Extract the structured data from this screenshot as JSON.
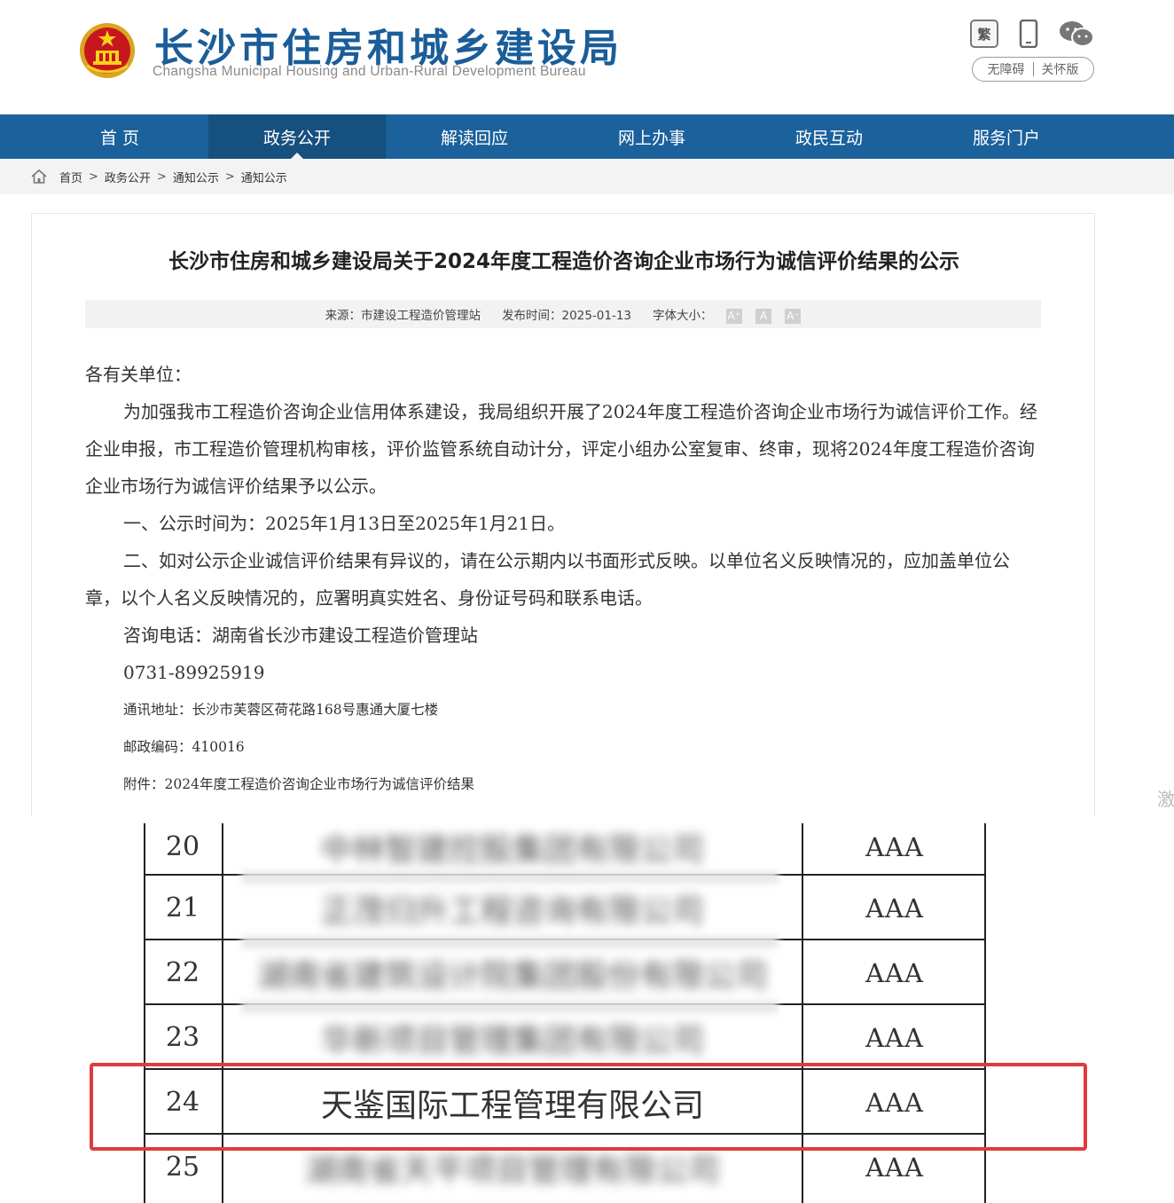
{
  "header": {
    "title": "长沙市住房和城乡建设局",
    "subtitle": "Changsha Municipal Housing and Urban-Rural Development Bureau",
    "traditional_label": "繁",
    "accessibility_label": "无障碍",
    "care_label": "关怀版"
  },
  "nav": {
    "items": [
      {
        "label": "首  页"
      },
      {
        "label": "政务公开"
      },
      {
        "label": "解读回应"
      },
      {
        "label": "网上办事"
      },
      {
        "label": "政民互动"
      },
      {
        "label": "服务门户"
      }
    ],
    "active_index": 1
  },
  "breadcrumb": [
    "首页",
    "政务公开",
    "通知公示",
    "通知公示"
  ],
  "breadcrumb_sep": ">",
  "article": {
    "title": "长沙市住房和城乡建设局关于2024年度工程造价咨询企业市场行为诚信评价结果的公示",
    "source": "来源：市建设工程造价管理站",
    "publish_time": "发布时间：2025-01-13",
    "font_size_label": "字体大小：",
    "font_buttons": [
      "A⁺",
      "A",
      "A⁻"
    ],
    "greeting": "各有关单位：",
    "para1": "为加强我市工程造价咨询企业信用体系建设，我局组织开展了2024年度工程造价咨询企业市场行为诚信评价工作。经企业申报，市工程造价管理机构审核，评价监管系统自动计分，评定小组办公室复审、终审，现将2024年度工程造价咨询企业市场行为诚信评价结果予以公示。",
    "para2": "一、公示时间为：2025年1月13日至2025年1月21日。",
    "para3": "二、如对公示企业诚信评价结果有异议的，请在公示期内以书面形式反映。以单位名义反映情况的，应加盖单位公章，以个人名义反映情况的，应署明真实姓名、身份证号码和联系电话。",
    "contact": "咨询电话：湖南省长沙市建设工程造价管理站",
    "phone": "0731-89925919",
    "address": "通讯地址：长沙市芙蓉区荷花路168号惠通大厦七楼",
    "postcode": "邮政编码：410016",
    "attachment": "附件：2024年度工程造价咨询企业市场行为诚信评价结果"
  },
  "side_char": "激",
  "table": {
    "rows": [
      {
        "num": "20",
        "name": "中林智建控股集团有限公司",
        "grade": "AAA",
        "blurred": true
      },
      {
        "num": "21",
        "name": "正茂归升工程咨询有限公司",
        "grade": "AAA",
        "blurred": true
      },
      {
        "num": "22",
        "name": "湖南省建筑设计院集团股份有限公司",
        "grade": "AAA",
        "blurred": true
      },
      {
        "num": "23",
        "name": "华新项目管理集团有限公司",
        "grade": "AAA",
        "blurred": true
      },
      {
        "num": "24",
        "name": "天鉴国际工程管理有限公司",
        "grade": "AAA",
        "blurred": false
      },
      {
        "num": "25",
        "name": "湖南省天平项目管理有限公司",
        "grade": "AAA",
        "blurred": true
      }
    ]
  },
  "colors": {
    "brand_blue": "#1b619b",
    "nav_active": "#16507f",
    "highlight_red": "#e03b3b"
  },
  "icons": [
    "national-emblem-icon",
    "traditional-chinese-icon",
    "mobile-phone-icon",
    "wechat-icon",
    "home-icon"
  ]
}
